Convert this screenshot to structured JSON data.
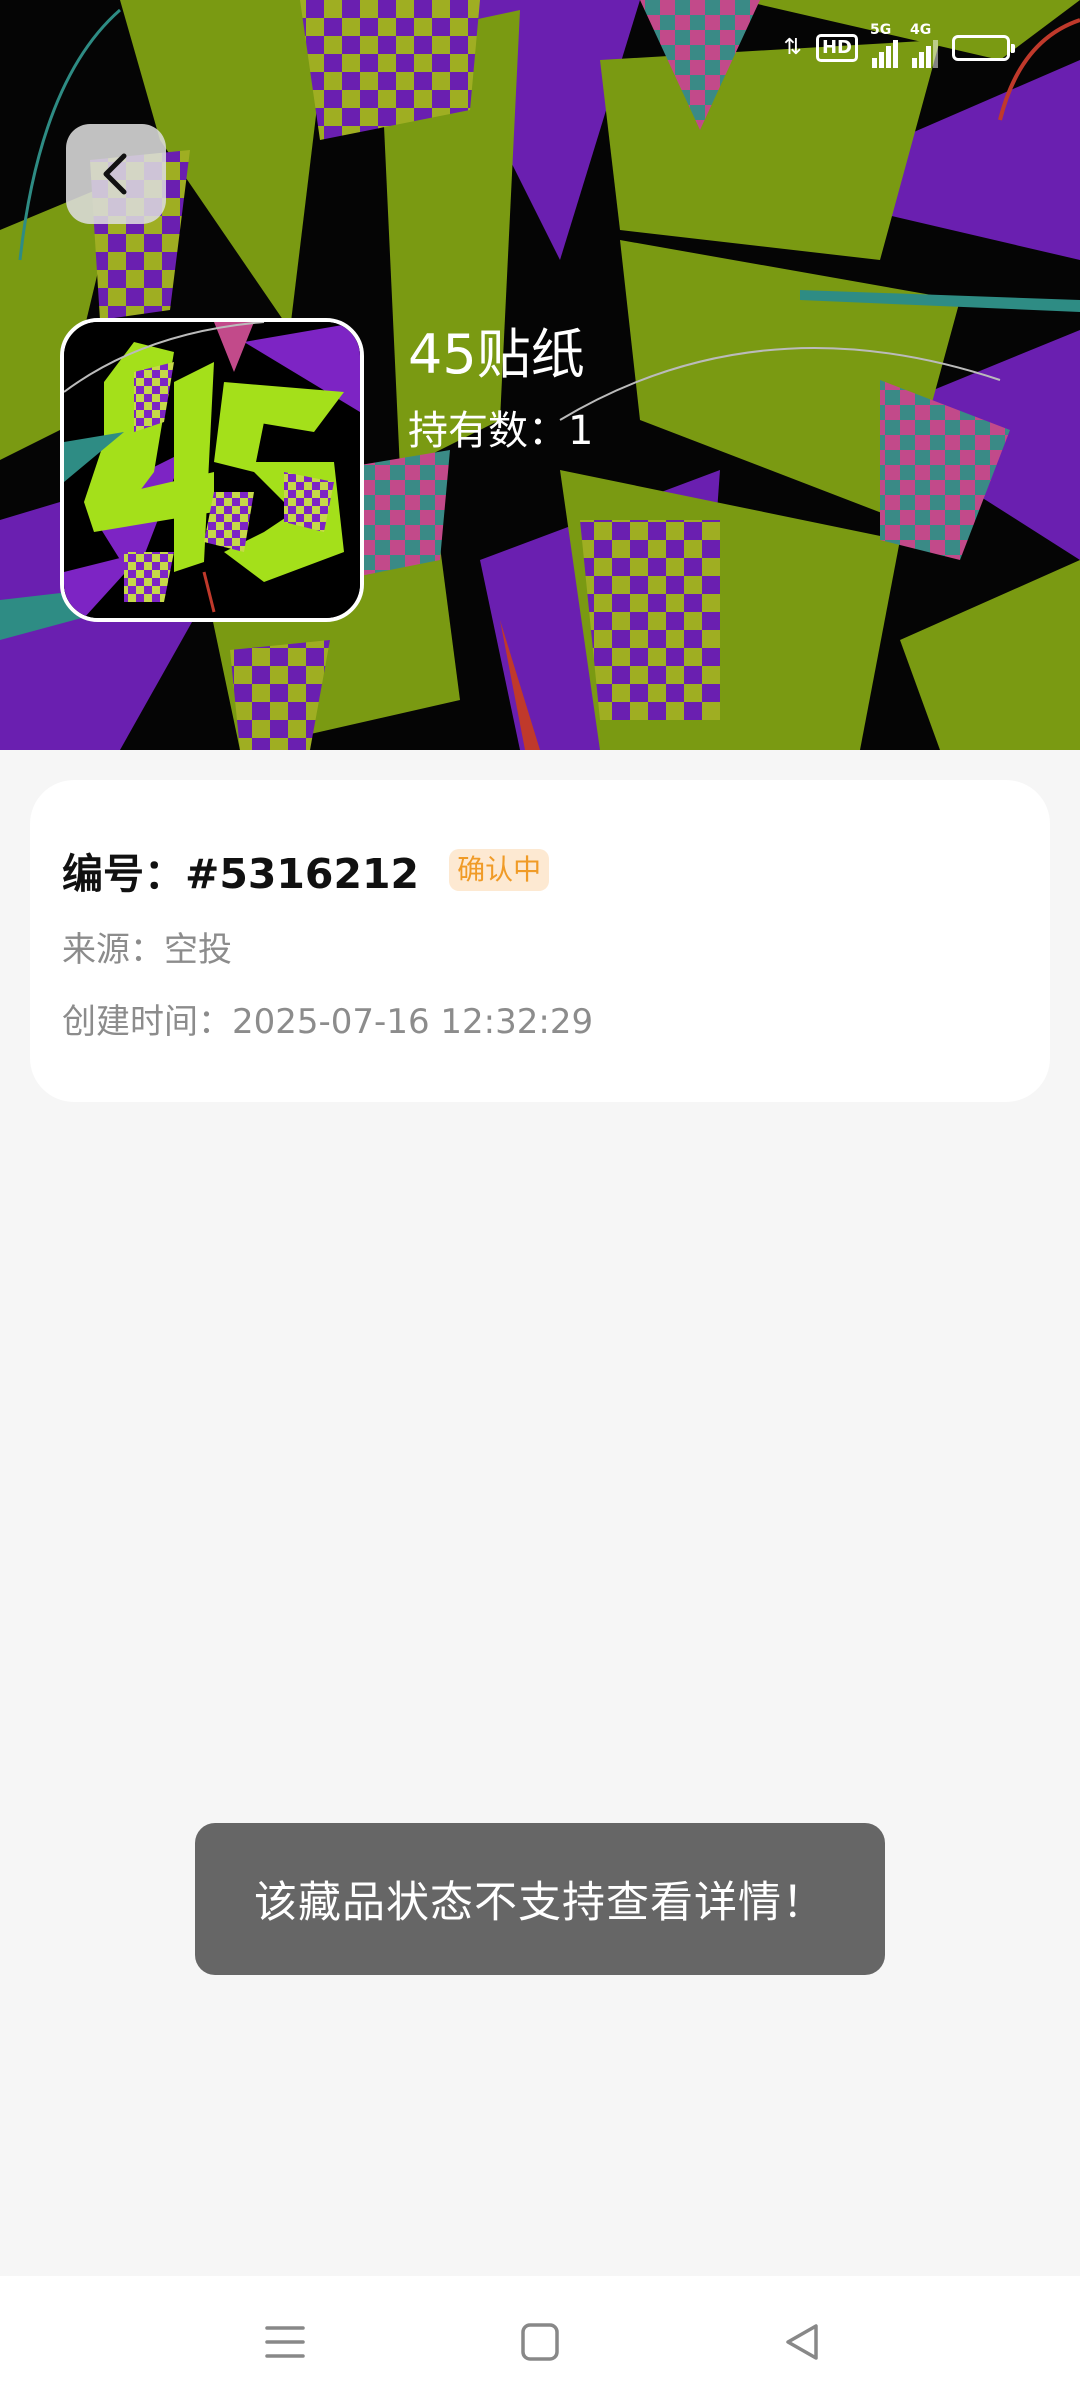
{
  "status_bar": {
    "network_hd": "HD",
    "signal_1_label": "5G",
    "signal_2_label": "4G"
  },
  "header": {
    "back_icon": "chevron-left-icon"
  },
  "item": {
    "name": "45贴纸",
    "holdings_text": "持有数：1"
  },
  "info": {
    "serial_text": "编号：#5316212",
    "status_badge": "确认中",
    "source_text": "来源：空投",
    "created_text": "创建时间：2025-07-16 12:32:29"
  },
  "toast": {
    "message": "该藏品状态不支持查看详情！"
  },
  "nav": {
    "menu_icon": "menu-icon",
    "home_icon": "home-square-icon",
    "back_icon": "back-triangle-icon"
  },
  "colors": {
    "artwork_green": "#7a9a12",
    "artwork_purple": "#6a1fb0",
    "artwork_pink": "#c24a8a",
    "badge_text": "#f09b27",
    "badge_bg": "#fde9d2",
    "toast_bg": "#666666",
    "page_bg": "#f6f6f6"
  }
}
